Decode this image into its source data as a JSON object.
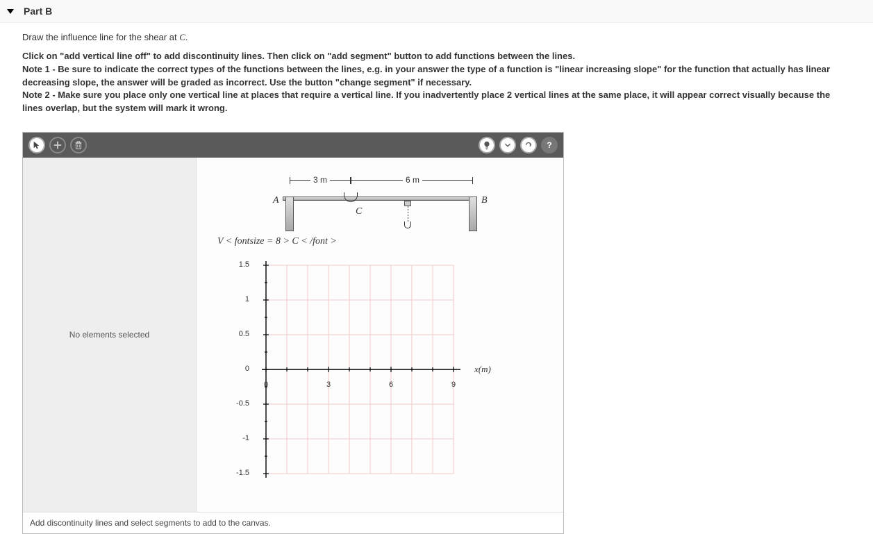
{
  "header": {
    "title": "Part B"
  },
  "instructions": {
    "line1_pre": "Draw the influence line for the shear at ",
    "line1_var": "C",
    "line1_post": ".",
    "notes": "Click on \"add vertical line off\" to add discontinuity lines. Then click on \"add segment\" button to add functions between the lines.\nNote 1 - Be sure to indicate the correct types of the functions between the lines, e.g. in your answer the type of a function is \"linear increasing slope\" for the function that actually has linear decreasing slope, the answer will be graded as incorrect. Use the button \"change segment\" if necessary.\nNote 2 - Make sure you place only one vertical line at places that require a vertical line. If you inadvertently place 2 vertical lines at the same place, it will appear correct visually because the lines overlap, but the system will mark it wrong."
  },
  "sidebar": {
    "status": "No elements selected"
  },
  "diagram": {
    "dim1": "3 m",
    "dim2": "6 m",
    "labelA": "A",
    "labelB": "B",
    "labelC": "C"
  },
  "chart_data": {
    "type": "line",
    "title": "V < fontsize = 8 > C < /font >",
    "xlabel": "x(m)",
    "ylabel": "",
    "xlim": [
      0,
      9
    ],
    "ylim": [
      -1.5,
      1.5
    ],
    "x_ticks": [
      0,
      3,
      6,
      9
    ],
    "y_ticks": [
      -1.5,
      -1.0,
      -0.5,
      0.0,
      0.5,
      1.0,
      1.5
    ],
    "series": []
  },
  "footer": {
    "msg": "Add discontinuity lines and select segments to add to the canvas."
  },
  "icons": {
    "cursor": "cursor",
    "add": "add",
    "trash": "trash",
    "hint": "hint",
    "dropdown": "dropdown",
    "redo": "redo",
    "help": "help"
  }
}
